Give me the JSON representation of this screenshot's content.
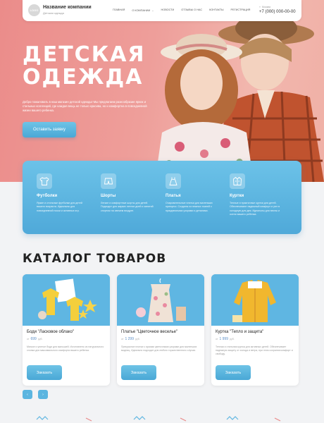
{
  "header": {
    "logo": "LOGO",
    "company_name": "Название компании",
    "company_sub": "Детская одежда",
    "nav": [
      {
        "label": "ГЛАВНАЯ"
      },
      {
        "label": "О КОМПАНИИ"
      },
      {
        "label": "НОВОСТИ"
      },
      {
        "label": "ОТЗЫВЫ О НАС"
      },
      {
        "label": "КОНТАКТЫ"
      },
      {
        "label": "РЕГИСТРАЦИЯ"
      }
    ],
    "city": "Москва",
    "phone": "+7 (000) 000-00-00"
  },
  "hero": {
    "title_line1": "ДЕТСКАЯ",
    "title_line2": "ОДЕЖДА",
    "text": "Добро пожаловать в наш магазин детской одежды! Мы предлагаем разнообразие ярких и стильных коллекций, где каждая вещь не только красива, но и комфортна в повседневной жизни вашего ребенка.",
    "button": "Оставить заявку"
  },
  "features": [
    {
      "icon": "tshirt-icon",
      "title": "Футболки",
      "text": "Яркие и стильные футболки для детей вашего возраста. Идеальны для повседневной носки и активных игр."
    },
    {
      "icon": "shorts-icon",
      "title": "Шорты",
      "text": "Легкие и комфортные шорты для детей. Подходят для жарких летних дней и занятий спортом на свежем воздухе."
    },
    {
      "icon": "dress-icon",
      "title": "Платья",
      "text": "Очаровательные платья для маленьких принцесс. Созданы из нежных тканей с праздничными узорами и деталями."
    },
    {
      "icon": "jacket-icon",
      "title": "Куртки",
      "text": "Теплые и практичные куртки для детей. Обеспечивают надежный комфорт и уют в холодную для дня. Идеальны для весны и осени вашего ребенка."
    }
  ],
  "catalog": {
    "title": "КАТАЛОГ ТОВАРОВ",
    "products": [
      {
        "name": "Боди \"Ласковое облако\"",
        "price_prefix": "от",
        "price": "699",
        "currency": "руб.",
        "desc": "Мягкое и уютное боди для малышей. Изготовлено из натурального хлопка для максимального комфорта вашего ребенка.",
        "button": "Заказать"
      },
      {
        "name": "Платье \"Цветочное веселье\"",
        "price_prefix": "от",
        "price": "1 299",
        "currency": "руб.",
        "desc": "Прекрасное платье с яркими цветочными узорами для маленьких модниц. Идеально подходит для любого торжественного случая.",
        "button": "Заказать"
      },
      {
        "name": "Куртка \"Тепло и защита\"",
        "price_prefix": "от",
        "price": "1 999",
        "currency": "руб.",
        "desc": "Теплая и стильная куртка для активных детей. Обеспечивает надежную защиту от холода и ветра, при этом сохраняя комфорт и свободу.",
        "button": "Заказать"
      }
    ],
    "prev": "‹",
    "next": "›"
  },
  "colors": {
    "accent": "#4fa9d9",
    "hero_pink": "#ee9e9a",
    "price": "#5b8fc7"
  }
}
